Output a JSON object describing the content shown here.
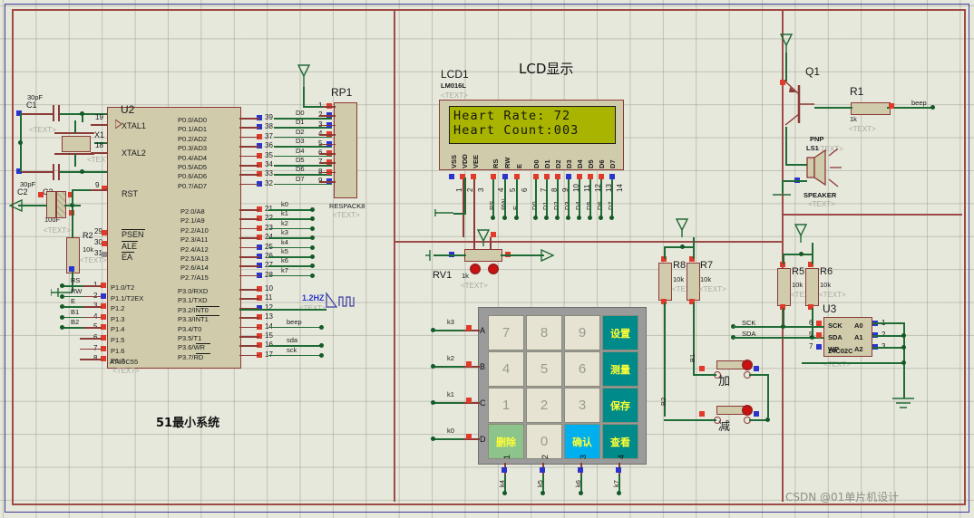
{
  "title_labels": {
    "lcd_section": "LCD显示",
    "mcu_section": "51最小系统",
    "watermark": "CSDN @01单片机设计"
  },
  "lcd": {
    "ref": "LCD1",
    "model": "LM016L",
    "text_tag": "<TEXT>",
    "line1": "Heart Rate: 72",
    "line2": "Heart Count:003",
    "left_pin_labels": [
      "VSS",
      "VDD",
      "VEE"
    ],
    "ctrl_pin_labels": [
      "RS",
      "RW",
      "E"
    ],
    "data_pin_labels": [
      "D0",
      "D1",
      "D2",
      "D3",
      "D4",
      "D5",
      "D6",
      "D7"
    ],
    "pin_numbers": [
      "1",
      "2",
      "3",
      "4",
      "5",
      "6",
      "7",
      "8",
      "9",
      "10",
      "11",
      "12",
      "13",
      "14"
    ],
    "net_ctrl": [
      "RS",
      "RW",
      "E"
    ],
    "net_data": [
      "D0",
      "D1",
      "D2",
      "D3",
      "D4",
      "D5",
      "D6",
      "D7"
    ]
  },
  "mcu": {
    "ref": "U2",
    "model": "AT89C55",
    "text_tag": "<TEXT>",
    "left_top_pins": [
      {
        "num": "19",
        "name": "XTAL1"
      },
      {
        "num": "18",
        "name": "XTAL2"
      },
      {
        "num": "9",
        "name": "RST"
      }
    ],
    "left_ctrl_pins": [
      {
        "num": "29",
        "name": "PSEN"
      },
      {
        "num": "30",
        "name": "ALE"
      },
      {
        "num": "31",
        "name": "EA"
      }
    ],
    "p1_pins": [
      {
        "num": "1",
        "name": "P1.0/T2",
        "net": "RS"
      },
      {
        "num": "2",
        "name": "P1.1/T2EX",
        "net": "RW"
      },
      {
        "num": "3",
        "name": "P1.2",
        "net": "E"
      },
      {
        "num": "4",
        "name": "P1.3",
        "net": "B1"
      },
      {
        "num": "5",
        "name": "P1.4",
        "net": "B2"
      },
      {
        "num": "6",
        "name": "P1.5",
        "net": ""
      },
      {
        "num": "7",
        "name": "P1.6",
        "net": ""
      },
      {
        "num": "8",
        "name": "P1.7",
        "net": ""
      }
    ],
    "p0_pins": [
      {
        "num": "39",
        "name": "P0.0/AD0",
        "net": "D0"
      },
      {
        "num": "38",
        "name": "P0.1/AD1",
        "net": "D1"
      },
      {
        "num": "37",
        "name": "P0.2/AD2",
        "net": "D2"
      },
      {
        "num": "36",
        "name": "P0.3/AD3",
        "net": "D3"
      },
      {
        "num": "35",
        "name": "P0.4/AD4",
        "net": "D4"
      },
      {
        "num": "34",
        "name": "P0.5/AD5",
        "net": "D5"
      },
      {
        "num": "33",
        "name": "P0.6/AD6",
        "net": "D6"
      },
      {
        "num": "32",
        "name": "P0.7/AD7",
        "net": "D7"
      }
    ],
    "p2_pins": [
      {
        "num": "21",
        "name": "P2.0/A8",
        "net": "k0"
      },
      {
        "num": "22",
        "name": "P2.1/A9",
        "net": "k1"
      },
      {
        "num": "23",
        "name": "P2.2/A10",
        "net": "k2"
      },
      {
        "num": "24",
        "name": "P2.3/A11",
        "net": "k3"
      },
      {
        "num": "25",
        "name": "P2.4/A12",
        "net": "k4"
      },
      {
        "num": "26",
        "name": "P2.5/A13",
        "net": "k5"
      },
      {
        "num": "27",
        "name": "P2.6/A14",
        "net": "k6"
      },
      {
        "num": "28",
        "name": "P2.7/A15",
        "net": "k7"
      }
    ],
    "p3_pins": [
      {
        "num": "10",
        "name": "P3.0/RXD",
        "net": ""
      },
      {
        "num": "11",
        "name": "P3.1/TXD",
        "net": ""
      },
      {
        "num": "12",
        "name": "P3.2/INT0",
        "net": ""
      },
      {
        "num": "13",
        "name": "P3.3/INT1",
        "net": ""
      },
      {
        "num": "14",
        "name": "P3.4/T0",
        "net": "beep"
      },
      {
        "num": "15",
        "name": "P3.5/T1",
        "net": ""
      },
      {
        "num": "16",
        "name": "P3.6/WR",
        "net": "sda"
      },
      {
        "num": "17",
        "name": "P3.7/RD",
        "net": "sck"
      }
    ]
  },
  "components": {
    "c1": {
      "ref": "C1",
      "value": "30pF"
    },
    "c2": {
      "ref": "C2",
      "value": "30pF"
    },
    "c3": {
      "ref": "C3",
      "value": "10uF",
      "text_tag": "<TEXT>"
    },
    "x1": {
      "ref": "X1",
      "text_tag": "<TEXT>"
    },
    "r2": {
      "ref": "R2",
      "value": "10k",
      "text_tag": "<TEXT>"
    },
    "rp1": {
      "ref": "RP1",
      "model": "RESPACK8",
      "text_tag": "<TEXT>",
      "pins": [
        "1",
        "2",
        "3",
        "4",
        "5",
        "6",
        "7",
        "8",
        "9"
      ]
    },
    "rv1": {
      "ref": "RV1",
      "value": "1k",
      "text_tag": "<TEXT>"
    },
    "q1": {
      "ref": "Q1",
      "type": "PNP",
      "text_tag": "<TEXT>"
    },
    "r1": {
      "ref": "R1",
      "value": "1k",
      "text_tag": "<TEXT>",
      "net": "beep"
    },
    "ls1": {
      "ref": "LS1",
      "model": "SPEAKER",
      "text_tag": "<TEXT>"
    },
    "r5": {
      "ref": "R5",
      "value": "10k",
      "text_tag": "<TEXT>"
    },
    "r6": {
      "ref": "R6",
      "value": "10k",
      "text_tag": "<TEXT>"
    },
    "r7": {
      "ref": "R7",
      "value": "10k",
      "text_tag": "<TEXT>"
    },
    "r8": {
      "ref": "R8",
      "value": "10k",
      "text_tag": "<TEXT>"
    },
    "u3": {
      "ref": "U3",
      "model": "24C02C",
      "text_tag": "<TEXT>",
      "left_pins": [
        {
          "num": "6",
          "name": "SCK"
        },
        {
          "num": "5",
          "name": "SDA"
        },
        {
          "num": "7",
          "name": "WP"
        }
      ],
      "right_pins": [
        {
          "num": "1",
          "name": "A0"
        },
        {
          "num": "2",
          "name": "A1"
        },
        {
          "num": "3",
          "name": "A2"
        }
      ]
    },
    "clock": {
      "value": "1.2HZ",
      "text_tag": "<TEXT>"
    },
    "btn_up": {
      "label": "加",
      "net": "B1"
    },
    "btn_down": {
      "label": "减",
      "net": "B2"
    },
    "nets_i2c": [
      "SCK",
      "SDA"
    ]
  },
  "keypad": {
    "row_labels": [
      "A",
      "B",
      "C",
      "D"
    ],
    "col_labels": [
      "1",
      "2",
      "3",
      "4"
    ],
    "row_nets": [
      "k3",
      "k2",
      "k1",
      "k0"
    ],
    "col_nets": [
      "k4",
      "k5",
      "k6",
      "k7"
    ],
    "keys": [
      [
        {
          "label": "7",
          "style": "num"
        },
        {
          "label": "8",
          "style": "num"
        },
        {
          "label": "9",
          "style": "num"
        },
        {
          "label": "设置",
          "style": "teal"
        }
      ],
      [
        {
          "label": "4",
          "style": "num"
        },
        {
          "label": "5",
          "style": "num"
        },
        {
          "label": "6",
          "style": "num"
        },
        {
          "label": "测量",
          "style": "teal"
        }
      ],
      [
        {
          "label": "1",
          "style": "num"
        },
        {
          "label": "2",
          "style": "num"
        },
        {
          "label": "3",
          "style": "num"
        },
        {
          "label": "保存",
          "style": "teal"
        }
      ],
      [
        {
          "label": "删除",
          "style": "green"
        },
        {
          "label": "0",
          "style": "num"
        },
        {
          "label": "确认",
          "style": "cyan"
        },
        {
          "label": "查看",
          "style": "teal"
        }
      ]
    ]
  },
  "colors": {
    "canvas": "#e7e8dc",
    "wire_green": "#1f6b35",
    "wire_red": "#8c3a36",
    "body_fill": "#cfcbab",
    "lcd_green": "#a8b400",
    "pin_red": "#e03a2a",
    "pin_blue": "#2b35cc"
  }
}
